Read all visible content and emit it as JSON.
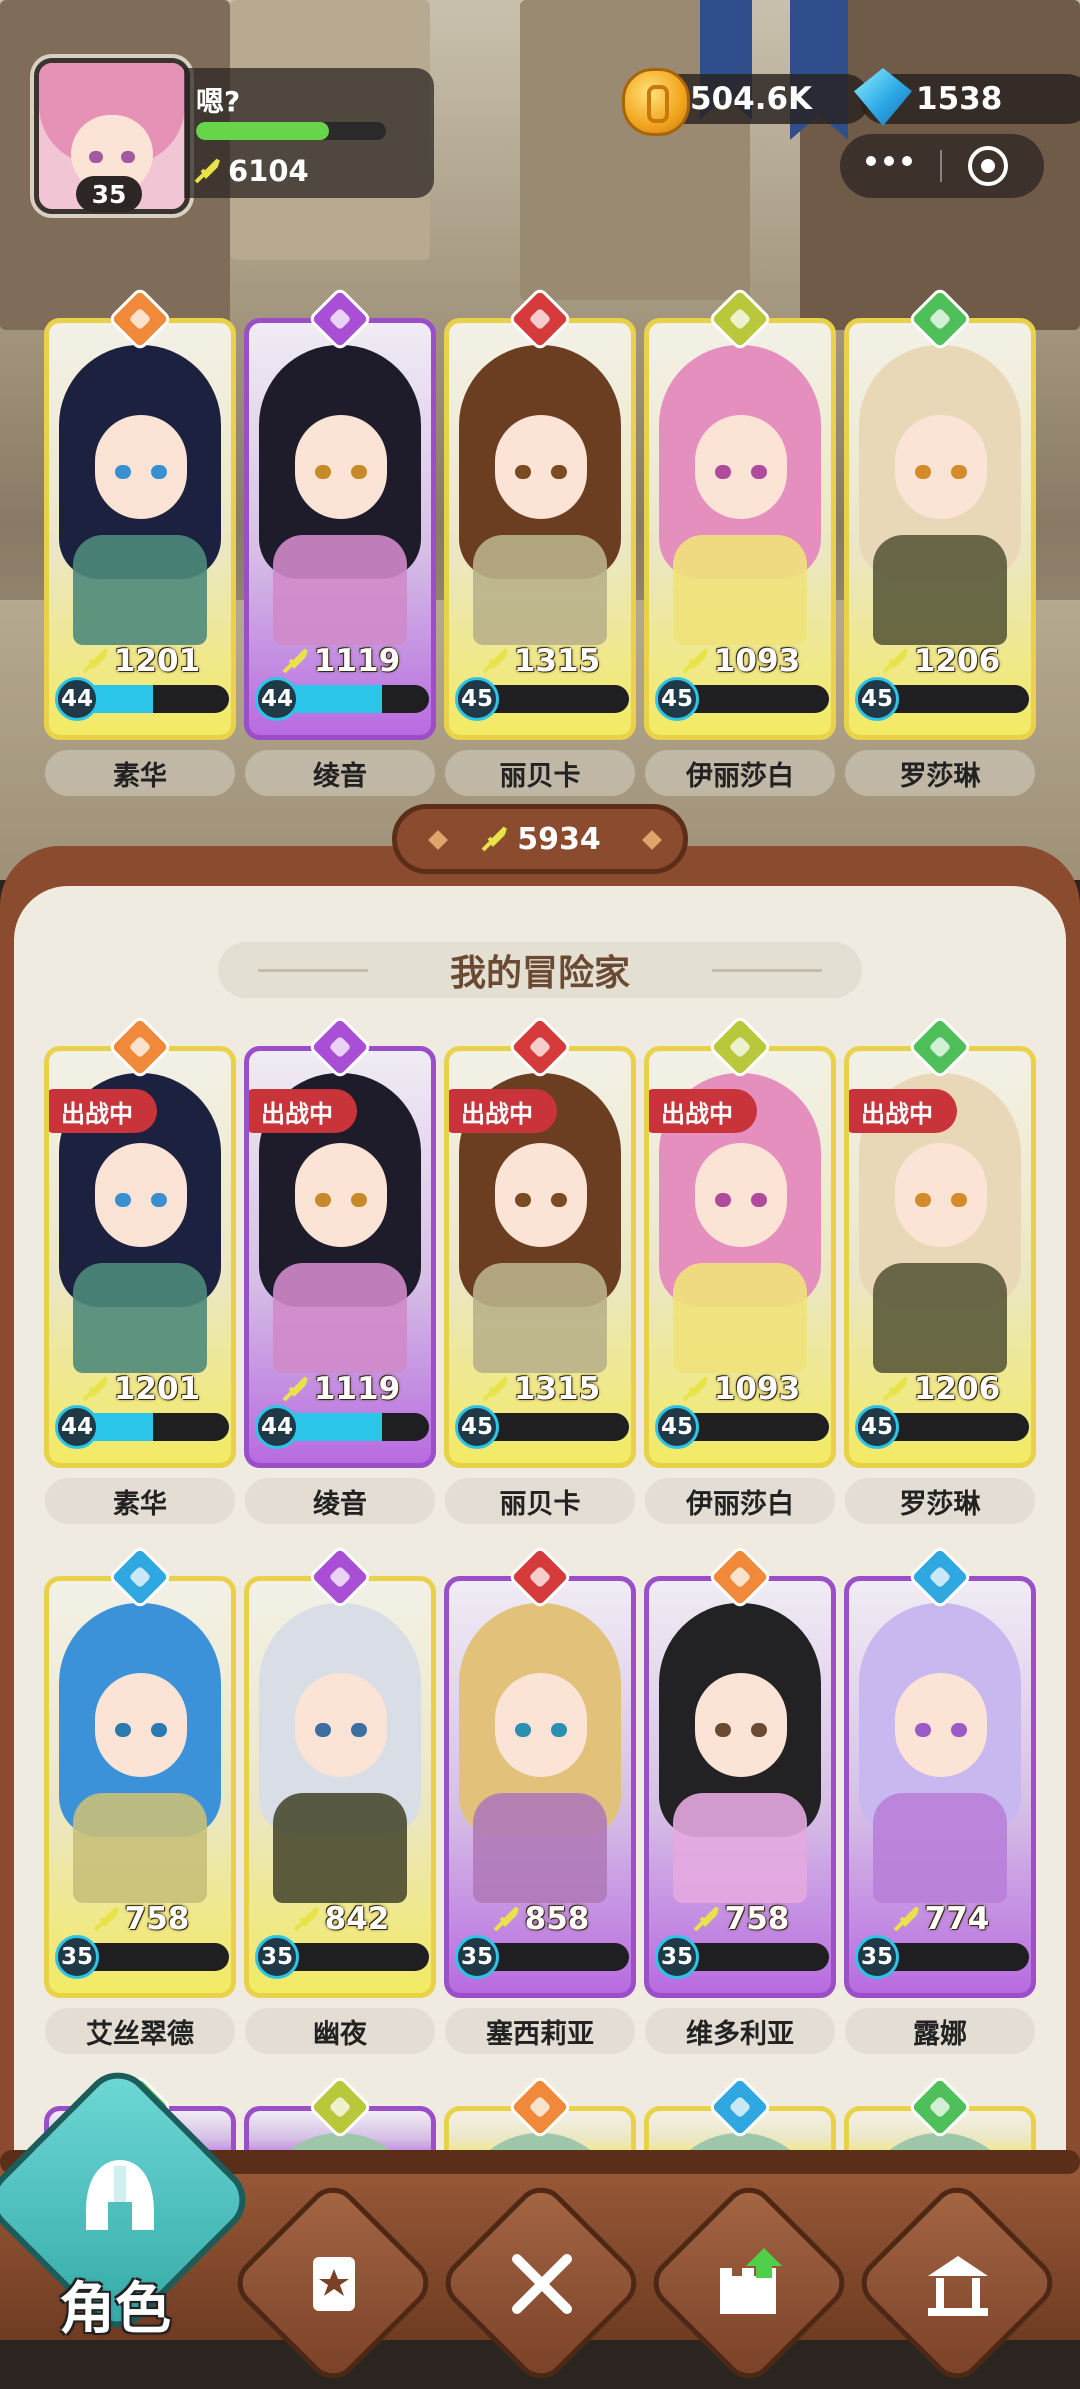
{
  "player": {
    "name": "嗯?",
    "level": "35",
    "power": "6104",
    "exp_fraction": 0.7
  },
  "resources": {
    "gold": "504.6K",
    "gems": "1538"
  },
  "team": {
    "total_power": "5934",
    "members": [
      {
        "name": "素华",
        "power": "1201",
        "level": "44",
        "progress": 0.55,
        "rarity": "gold",
        "element_color": "#f08a3a",
        "hair": "#1d2140",
        "eye": "#3a8fd0",
        "body": "#4e8a7a"
      },
      {
        "name": "绫音",
        "power": "1119",
        "level": "44",
        "progress": 0.72,
        "rarity": "purple",
        "element_color": "#a84fd6",
        "hair": "#1e1c2a",
        "eye": "#c68a2a",
        "body": "#d08ac9"
      },
      {
        "name": "丽贝卡",
        "power": "1315",
        "level": "45",
        "progress": 0.12,
        "rarity": "gold",
        "element_color": "#d63b3b",
        "hair": "#6b3e22",
        "eye": "#7a4a22",
        "body": "#b9b18a"
      },
      {
        "name": "伊丽莎白",
        "power": "1093",
        "level": "45",
        "progress": 0.05,
        "rarity": "gold",
        "element_color": "#b9c83a",
        "hair": "#e58fbf",
        "eye": "#b04a9a",
        "body": "#f0e27a"
      },
      {
        "name": "罗莎琳",
        "power": "1206",
        "level": "45",
        "progress": 0.05,
        "rarity": "gold",
        "element_color": "#4fbf5a",
        "hair": "#e8d8b8",
        "eye": "#d28a2a",
        "body": "#5a5a3a"
      }
    ]
  },
  "roster": {
    "title": "我的冒险家",
    "deployed_label": "出战中",
    "row1": [
      {
        "name": "素华",
        "power": "1201",
        "level": "44",
        "progress": 0.55,
        "rarity": "gold",
        "element_color": "#f08a3a",
        "hair": "#1d2140",
        "eye": "#3a8fd0",
        "body": "#4e8a7a",
        "deployed": true
      },
      {
        "name": "绫音",
        "power": "1119",
        "level": "44",
        "progress": 0.72,
        "rarity": "purple",
        "element_color": "#a84fd6",
        "hair": "#1e1c2a",
        "eye": "#c68a2a",
        "body": "#d08ac9",
        "deployed": true
      },
      {
        "name": "丽贝卡",
        "power": "1315",
        "level": "45",
        "progress": 0.12,
        "rarity": "gold",
        "element_color": "#d63b3b",
        "hair": "#6b3e22",
        "eye": "#7a4a22",
        "body": "#b9b18a",
        "deployed": true
      },
      {
        "name": "伊丽莎白",
        "power": "1093",
        "level": "45",
        "progress": 0.05,
        "rarity": "gold",
        "element_color": "#b9c83a",
        "hair": "#e58fbf",
        "eye": "#b04a9a",
        "body": "#f0e27a",
        "deployed": true
      },
      {
        "name": "罗莎琳",
        "power": "1206",
        "level": "45",
        "progress": 0.05,
        "rarity": "gold",
        "element_color": "#4fbf5a",
        "hair": "#e8d8b8",
        "eye": "#d28a2a",
        "body": "#5a5a3a",
        "deployed": true
      }
    ],
    "row2": [
      {
        "name": "艾丝翠德",
        "power": "758",
        "level": "35",
        "progress": 0.0,
        "rarity": "gold",
        "element_color": "#2fa7e0",
        "hair": "#3c92d8",
        "eye": "#2a7ab0",
        "body": "#c8c07a"
      },
      {
        "name": "幽夜",
        "power": "842",
        "level": "35",
        "progress": 0.0,
        "rarity": "gold",
        "element_color": "#a84fd6",
        "hair": "#d8dde6",
        "eye": "#3a6fa0",
        "body": "#4a4a30"
      },
      {
        "name": "塞西莉亚",
        "power": "858",
        "level": "35",
        "progress": 0.0,
        "rarity": "purple",
        "element_color": "#d63b3b",
        "hair": "#e2c27a",
        "eye": "#2a8fb0",
        "body": "#b07ab8"
      },
      {
        "name": "维多利亚",
        "power": "758",
        "level": "35",
        "progress": 0.0,
        "rarity": "purple",
        "element_color": "#f08a3a",
        "hair": "#222225",
        "eye": "#6a4a30",
        "body": "#e4a8e0"
      },
      {
        "name": "露娜",
        "power": "774",
        "level": "35",
        "progress": 0.0,
        "rarity": "purple",
        "element_color": "#2fa7e0",
        "hair": "#c9b8ef",
        "eye": "#9a5ac8",
        "body": "#b880d8"
      }
    ]
  },
  "nav": {
    "active_label": "角色",
    "items": [
      "character-icon",
      "book-icon",
      "battle-icon",
      "castle-upgrade-icon",
      "shrine-icon"
    ]
  }
}
